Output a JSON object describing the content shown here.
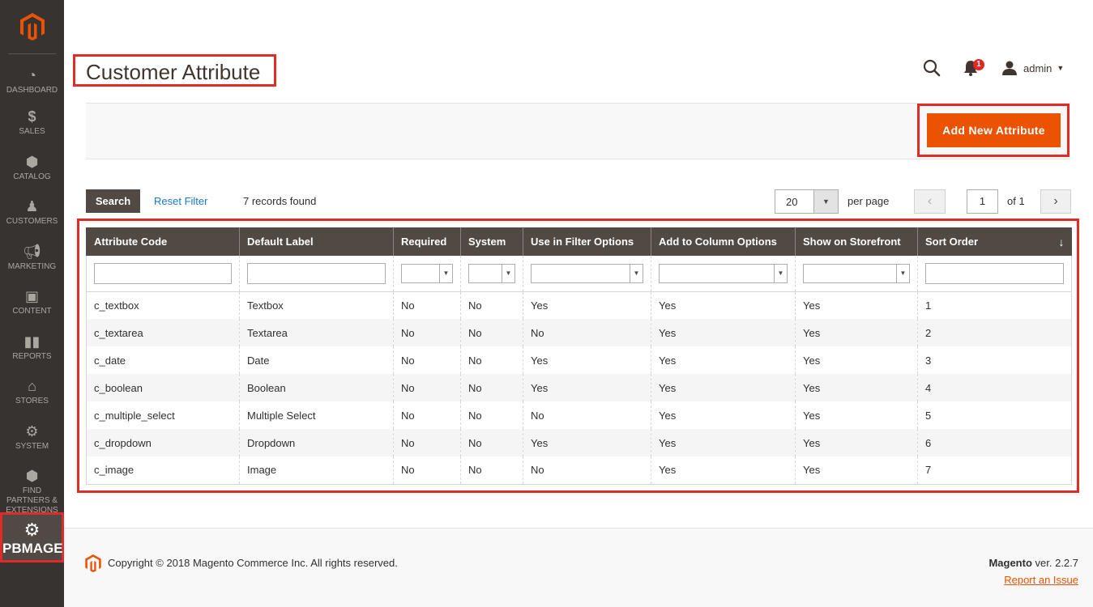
{
  "sidebar": {
    "items": [
      {
        "label": "DASHBOARD",
        "icon": "dashboard-icon"
      },
      {
        "label": "SALES",
        "icon": "dollar-icon"
      },
      {
        "label": "CATALOG",
        "icon": "box-icon"
      },
      {
        "label": "CUSTOMERS",
        "icon": "person-icon"
      },
      {
        "label": "MARKETING",
        "icon": "megaphone-icon"
      },
      {
        "label": "CONTENT",
        "icon": "layout-icon"
      },
      {
        "label": "REPORTS",
        "icon": "bar-chart-icon"
      },
      {
        "label": "STORES",
        "icon": "store-icon"
      },
      {
        "label": "SYSTEM",
        "icon": "gear-icon"
      },
      {
        "label": "FIND PARTNERS & EXTENSIONS",
        "icon": "extensions-icon"
      }
    ],
    "pbmage": {
      "label": "PBMAGE",
      "icon": "gear-icon"
    }
  },
  "header": {
    "title": "Customer Attribute",
    "notification_count": "1",
    "user_name": "admin"
  },
  "actions": {
    "add_label": "Add New Attribute"
  },
  "grid_controls": {
    "search_label": "Search",
    "reset_label": "Reset Filter",
    "records": "7 records found",
    "per_page_value": "20",
    "per_page_label": "per page",
    "page_value": "1",
    "page_of": "of 1"
  },
  "grid": {
    "columns": [
      "Attribute Code",
      "Default Label",
      "Required",
      "System",
      "Use in Filter Options",
      "Add to Column Options",
      "Show on Storefront",
      "Sort Order"
    ],
    "sort_indicator": "↓",
    "rows": [
      [
        "c_textbox",
        "Textbox",
        "No",
        "No",
        "Yes",
        "Yes",
        "Yes",
        "1"
      ],
      [
        "c_textarea",
        "Textarea",
        "No",
        "No",
        "No",
        "Yes",
        "Yes",
        "2"
      ],
      [
        "c_date",
        "Date",
        "No",
        "No",
        "Yes",
        "Yes",
        "Yes",
        "3"
      ],
      [
        "c_boolean",
        "Boolean",
        "No",
        "No",
        "Yes",
        "Yes",
        "Yes",
        "4"
      ],
      [
        "c_multiple_select",
        "Multiple Select",
        "No",
        "No",
        "No",
        "Yes",
        "Yes",
        "5"
      ],
      [
        "c_dropdown",
        "Dropdown",
        "No",
        "No",
        "Yes",
        "Yes",
        "Yes",
        "6"
      ],
      [
        "c_image",
        "Image",
        "No",
        "No",
        "No",
        "Yes",
        "Yes",
        "7"
      ]
    ]
  },
  "footer": {
    "copyright": "Copyright © 2018 Magento Commerce Inc. All rights reserved.",
    "brand": "Magento",
    "version": " ver. 2.2.7",
    "report_label": "Report an Issue"
  },
  "colors": {
    "accent": "#eb5202",
    "sidebar": "#373330",
    "grid_header": "#514943",
    "highlight": "#e02b27"
  }
}
